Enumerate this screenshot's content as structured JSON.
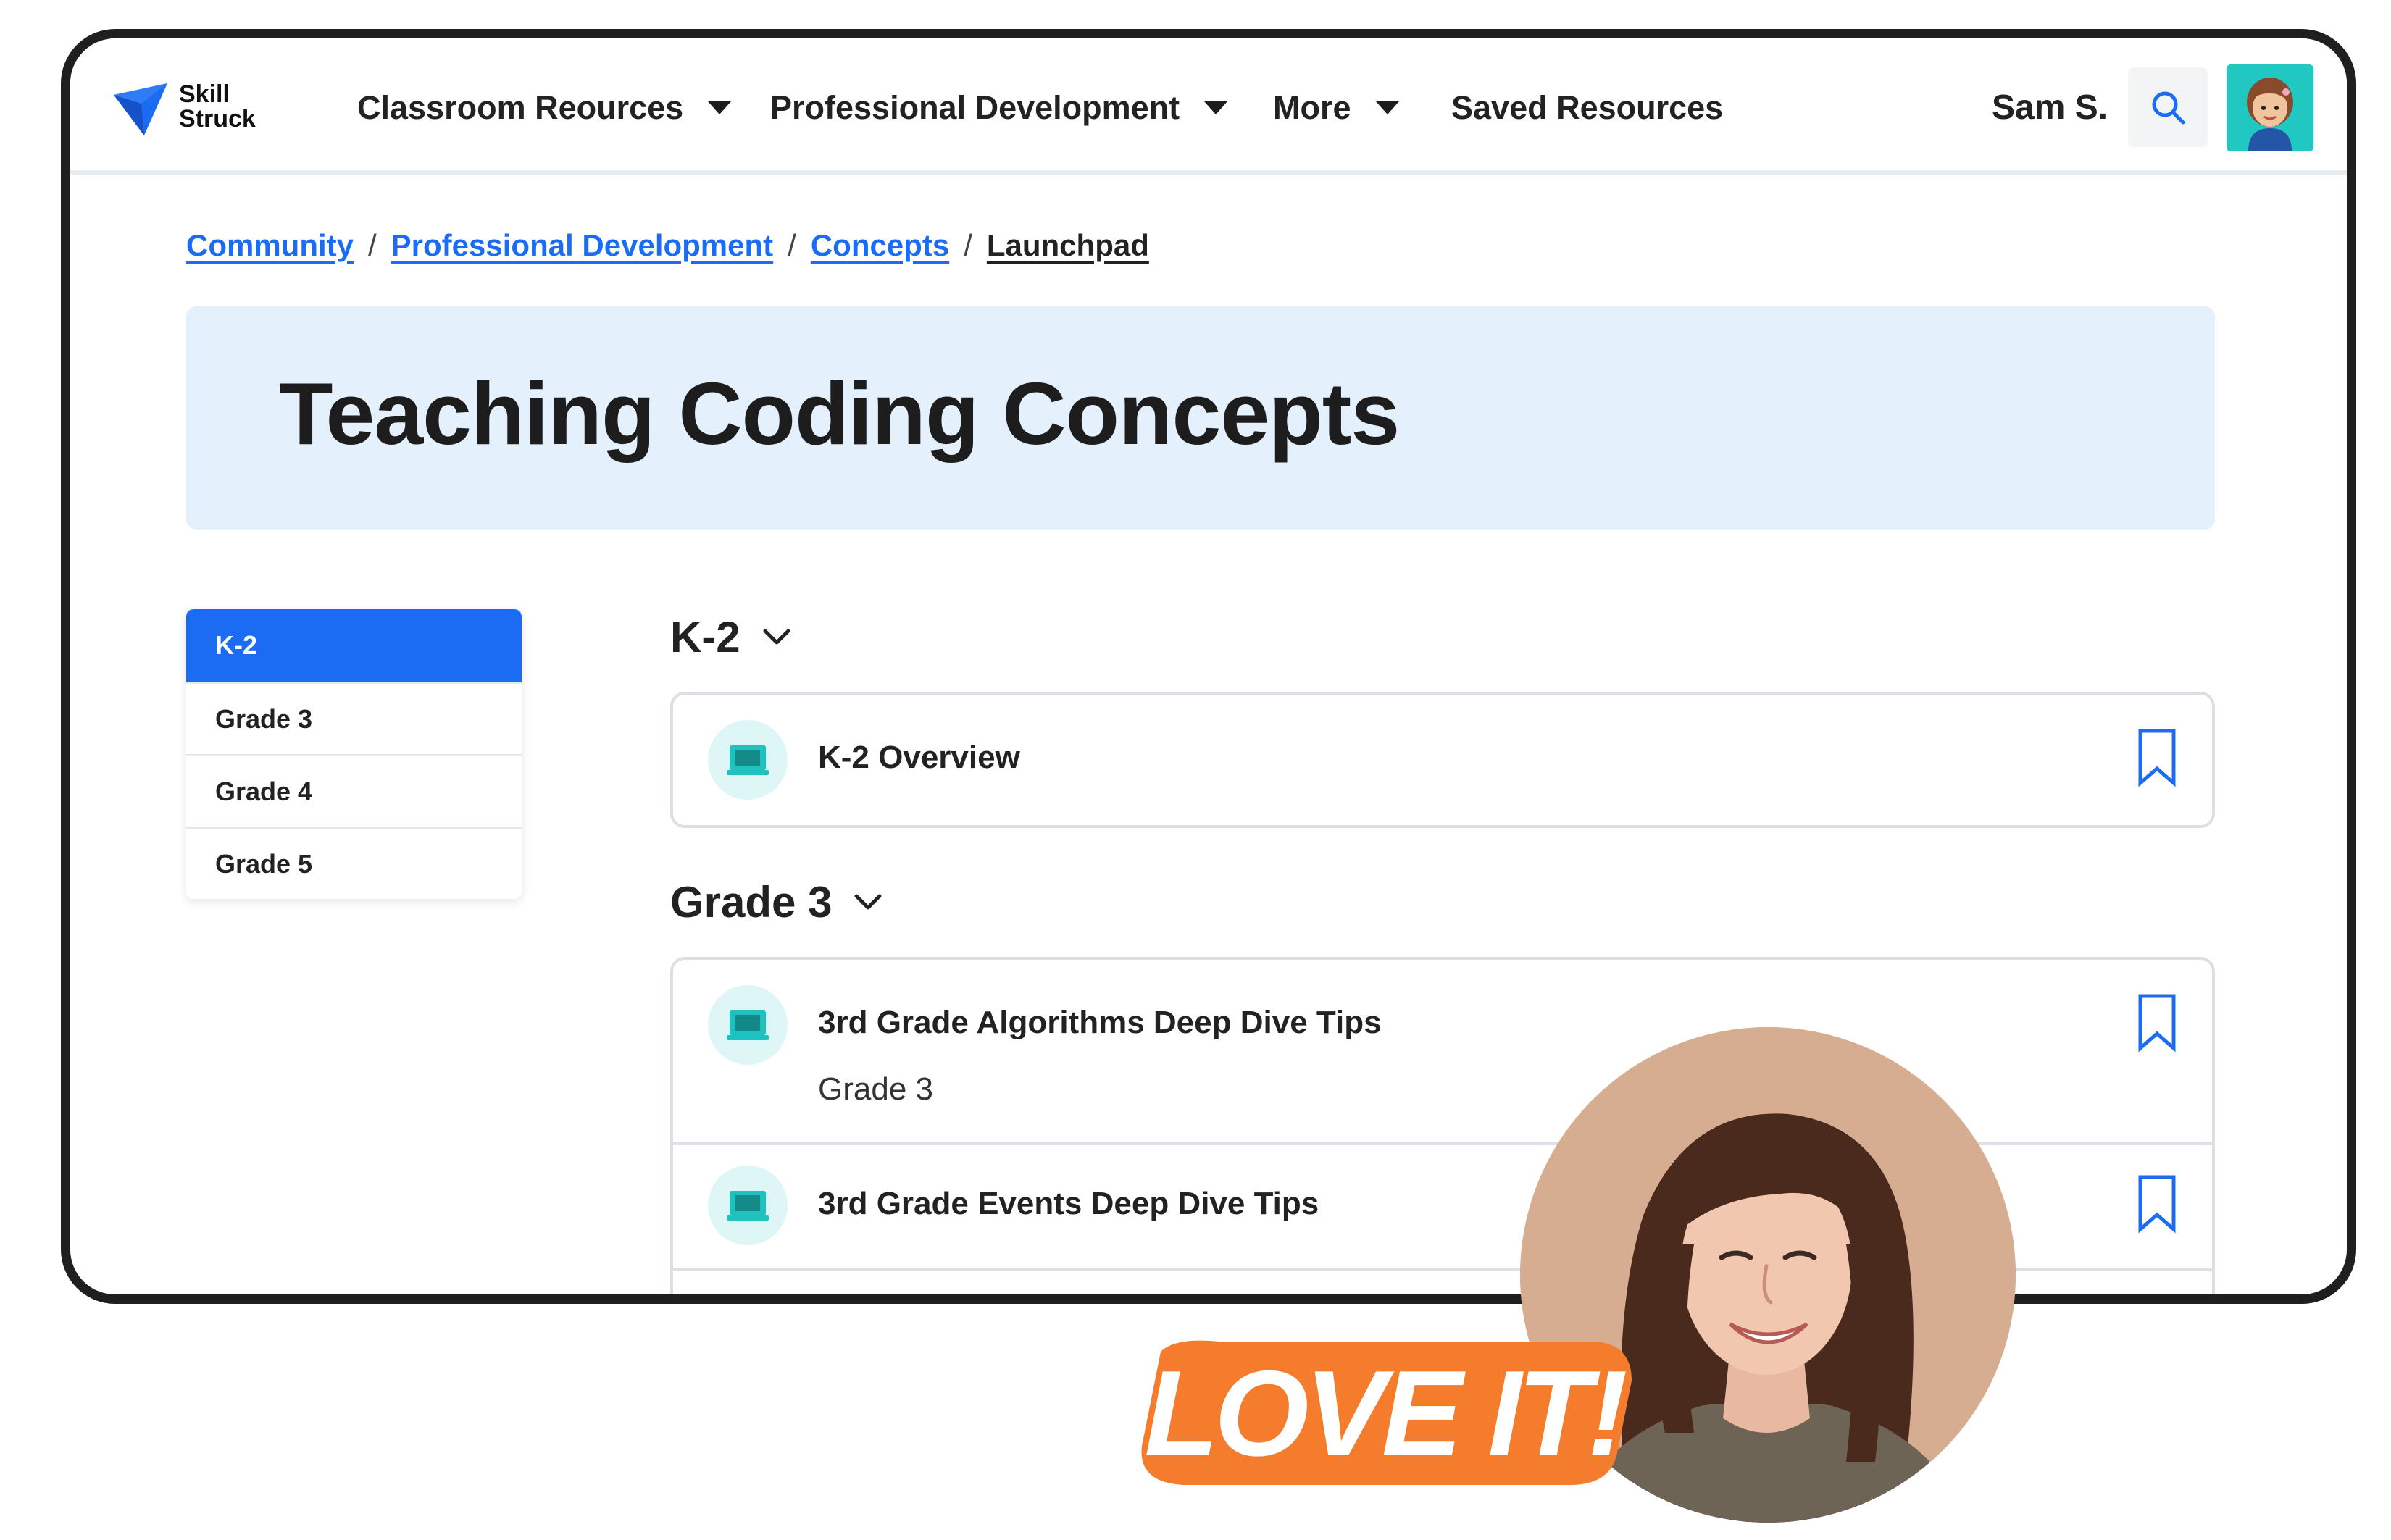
{
  "brand": {
    "line1": "Skill",
    "line2": "Struck",
    "accent": "#1b6cf2"
  },
  "nav": {
    "items": [
      {
        "label": "Classroom Reources",
        "dropdown": true
      },
      {
        "label": "Professional Development",
        "dropdown": true
      },
      {
        "label": "More",
        "dropdown": true
      },
      {
        "label": "Saved Resources",
        "dropdown": false
      }
    ],
    "user_name": "Sam S.",
    "search_icon": "search-icon",
    "avatar_icon": "user-avatar"
  },
  "breadcrumb": {
    "items": [
      "Community",
      "Professional Development",
      "Concepts"
    ],
    "current": "Launchpad",
    "separator": "/"
  },
  "banner": {
    "title": "Teaching Coding Concepts",
    "background": "#e5f0fd"
  },
  "sidebar": {
    "tabs": [
      {
        "label": "K-2",
        "active": true
      },
      {
        "label": "Grade 3",
        "active": false
      },
      {
        "label": "Grade 4",
        "active": false
      },
      {
        "label": "Grade 5",
        "active": false
      }
    ]
  },
  "sections": [
    {
      "heading": "K-2",
      "resources": [
        {
          "title": "K-2 Overview",
          "subtitle": ""
        }
      ]
    },
    {
      "heading": "Grade 3",
      "resources": [
        {
          "title": "3rd Grade Algorithms Deep Dive Tips",
          "subtitle": "Grade 3"
        },
        {
          "title": "3rd Grade Events Deep Dive Tips",
          "subtitle": ""
        }
      ]
    }
  ],
  "overlay": {
    "sticker_text": "LOVE IT!",
    "sticker_color": "#f47c2c",
    "photo": "person-photo"
  }
}
